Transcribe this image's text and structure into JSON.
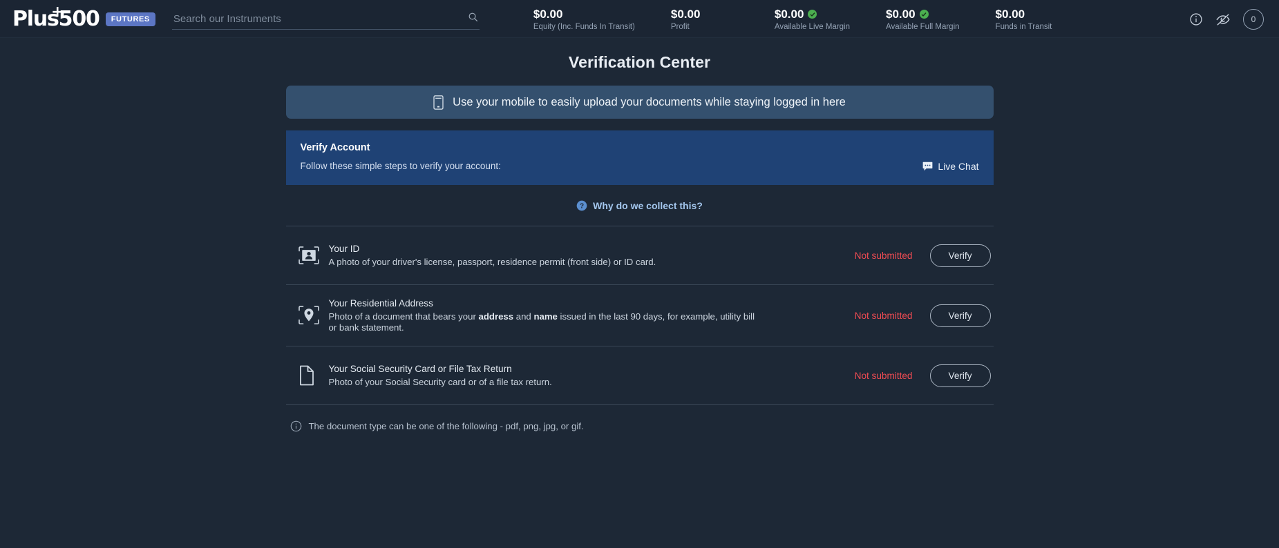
{
  "topbar": {
    "logo": {
      "text": "Plus500",
      "plus_glyph": "+",
      "badge": "FUTURES"
    },
    "search": {
      "placeholder": "Search our Instruments",
      "value": "",
      "icon": "search-icon"
    },
    "metrics": [
      {
        "value": "$0.00",
        "label": "Equity (Inc. Funds In Transit)",
        "verified": false
      },
      {
        "value": "$0.00",
        "label": "Profit",
        "verified": false
      },
      {
        "value": "$0.00",
        "label": "Available Live Margin",
        "verified": true
      },
      {
        "value": "$0.00",
        "label": "Available Full Margin",
        "verified": true
      },
      {
        "value": "$0.00",
        "label": "Funds in Transit",
        "verified": false
      }
    ],
    "actions": {
      "info_icon": "info-circle-icon",
      "hide_icon": "eye-off-icon",
      "notification_count": "0"
    }
  },
  "main": {
    "page_title": "Verification Center",
    "mobile_banner": {
      "icon": "mobile-phone-icon",
      "text": "Use your mobile to easily upload your documents while staying logged in here"
    },
    "verify_panel": {
      "title": "Verify Account",
      "subtitle": "Follow these simple steps to verify your account:",
      "live_chat_label": "Live Chat",
      "live_chat_icon": "chat-bubble-icon"
    },
    "why_link": {
      "label": "Why do we collect this?",
      "icon": "question-circle-icon"
    },
    "documents": [
      {
        "icon": "id-card-icon",
        "title": "Your ID",
        "description": "A photo of your driver's license, passport, residence permit (front side) or ID card.",
        "status": "Not submitted",
        "action_label": "Verify"
      },
      {
        "icon": "location-pin-icon",
        "title": "Your Residential Address",
        "description_parts": [
          {
            "text": "Photo of a document that bears your ",
            "bold": false
          },
          {
            "text": "address",
            "bold": true
          },
          {
            "text": " and ",
            "bold": false
          },
          {
            "text": "name",
            "bold": true
          },
          {
            "text": " issued in the last 90 days, for example, utility bill or bank statement.",
            "bold": false
          }
        ],
        "status": "Not submitted",
        "action_label": "Verify"
      },
      {
        "icon": "document-page-icon",
        "title": "Your Social Security Card or File Tax Return",
        "description": "Photo of your Social Security card or of a file tax return.",
        "status": "Not submitted",
        "action_label": "Verify"
      }
    ],
    "footnote": {
      "icon": "info-circle-icon",
      "text": "The document type can be one of the following - pdf, png, jpg, or gif."
    }
  },
  "colors": {
    "page_bg": "#1d2836",
    "topbar_bg": "#1b2533",
    "banner_bg": "#34506e",
    "panel_bg": "#1f4275",
    "accent_link": "#a4c7ee",
    "status_error": "#ef4b52",
    "verified_green": "#4caf50",
    "badge_blue": "#5c76c4"
  }
}
